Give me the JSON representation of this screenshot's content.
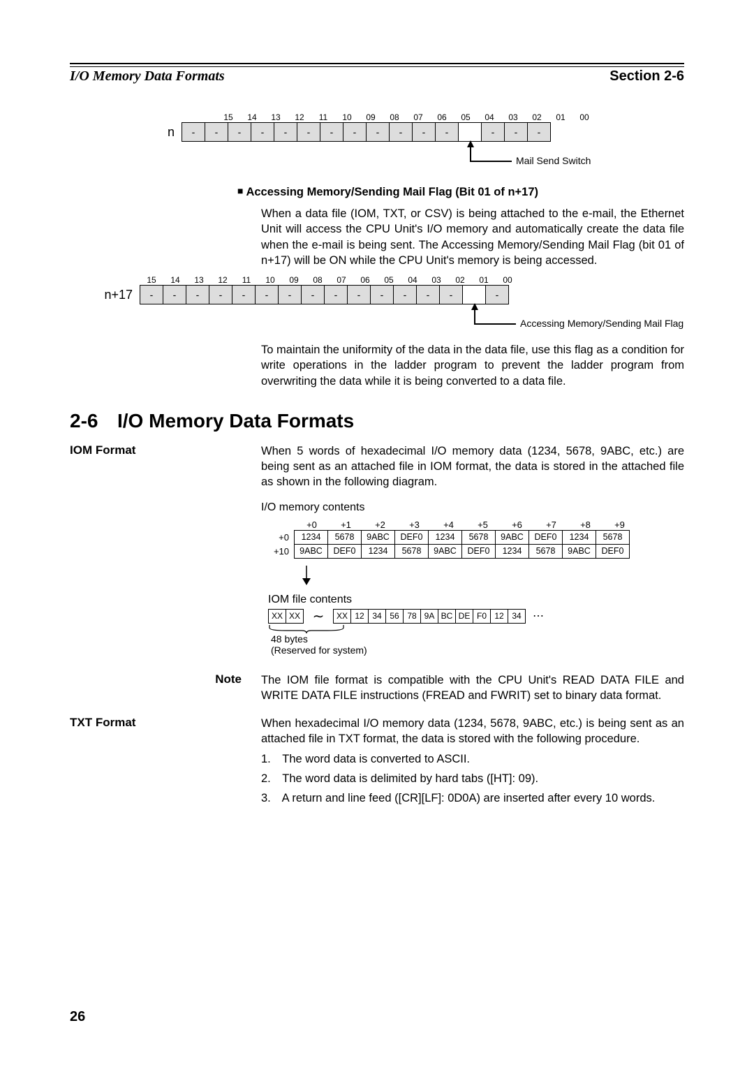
{
  "header": {
    "left": "I/O Memory Data Formats",
    "right": "Section 2-6"
  },
  "diagram1": {
    "row_label": "n",
    "bit_numbers": [
      "15",
      "14",
      "13",
      "12",
      "11",
      "10",
      "09",
      "08",
      "07",
      "06",
      "05",
      "04",
      "03",
      "02",
      "01",
      "00"
    ],
    "cells": [
      "-",
      "-",
      "-",
      "-",
      "-",
      "-",
      "-",
      "-",
      "-",
      "-",
      "-",
      "-",
      "",
      "-",
      "-",
      "-"
    ],
    "shaded": [
      true,
      true,
      true,
      true,
      true,
      true,
      true,
      true,
      true,
      true,
      true,
      true,
      false,
      true,
      true,
      true
    ],
    "pointer_bit": 3,
    "pointer_text": "Mail Send Switch"
  },
  "subhead1": "Accessing Memory/Sending Mail Flag (Bit 01 of n+17)",
  "para1": "When a data file (IOM, TXT, or CSV) is being attached to the e-mail, the Ethernet Unit will access the CPU Unit's I/O memory and automatically create the data file when the e-mail is being sent. The Accessing Memory/Sending Mail Flag (bit 01 of n+17) will be ON while the CPU Unit's memory is being accessed.",
  "diagram2": {
    "row_label": "n+17",
    "bit_numbers": [
      "15",
      "14",
      "13",
      "12",
      "11",
      "10",
      "09",
      "08",
      "07",
      "06",
      "05",
      "04",
      "03",
      "02",
      "01",
      "00"
    ],
    "cells": [
      "-",
      "-",
      "-",
      "-",
      "-",
      "-",
      "-",
      "-",
      "-",
      "-",
      "-",
      "-",
      "-",
      "-",
      "",
      "-"
    ],
    "shaded": [
      true,
      true,
      true,
      true,
      true,
      true,
      true,
      true,
      true,
      true,
      true,
      true,
      true,
      true,
      false,
      true
    ],
    "pointer_bit": 1,
    "pointer_text": "Accessing Memory/Sending Mail Flag"
  },
  "para2": "To maintain the uniformity of the data in the data file, use this flag as a condition for write operations in the ladder program to prevent the ladder program from overwriting the data while it is being converted to a data file.",
  "section": {
    "num": "2-6",
    "title": "I/O Memory Data Formats"
  },
  "iom_format": {
    "label": "IOM Format",
    "para": "When 5 words of hexadecimal I/O memory data (1234, 5678, 9ABC, etc.) are being sent as an attached file in IOM format, the data is stored in the attached file as shown in the following diagram.",
    "mem_title": "I/O memory contents",
    "col_offsets": [
      "+0",
      "+1",
      "+2",
      "+3",
      "+4",
      "+5",
      "+6",
      "+7",
      "+8",
      "+9"
    ],
    "row0_lbl": "+0",
    "row0": [
      "1234",
      "5678",
      "9ABC",
      "DEF0",
      "1234",
      "5678",
      "9ABC",
      "DEF0",
      "1234",
      "5678"
    ],
    "row10_lbl": "+10",
    "row10": [
      "9ABC",
      "DEF0",
      "1234",
      "5678",
      "9ABC",
      "DEF0",
      "1234",
      "5678",
      "9ABC",
      "DEF0"
    ],
    "iom_title": "IOM file contents",
    "iom_cells": [
      "XX",
      "XX",
      "∼",
      "XX",
      "12",
      "34",
      "56",
      "78",
      "9A",
      "BC",
      "DE",
      "F0",
      "12",
      "34"
    ],
    "iom_dots": "⋯",
    "brace_line1": "48 bytes",
    "brace_line2": "(Reserved for system)"
  },
  "note": {
    "label": "Note",
    "text": "The IOM file format is compatible with the CPU Unit's READ DATA FILE and WRITE DATA FILE instructions (FREAD and FWRIT) set to binary data format."
  },
  "txt_format": {
    "label": "TXT Format",
    "para": "When hexadecimal I/O memory data (1234, 5678, 9ABC, etc.) is being sent as an attached file in TXT format, the data is stored with the following procedure.",
    "list": [
      "The word data is converted to ASCII.",
      "The word data is delimited by hard tabs ([HT]: 09).",
      "A return and line feed ([CR][LF]: 0D0A) are inserted after every 10 words."
    ]
  },
  "page_number": "26"
}
